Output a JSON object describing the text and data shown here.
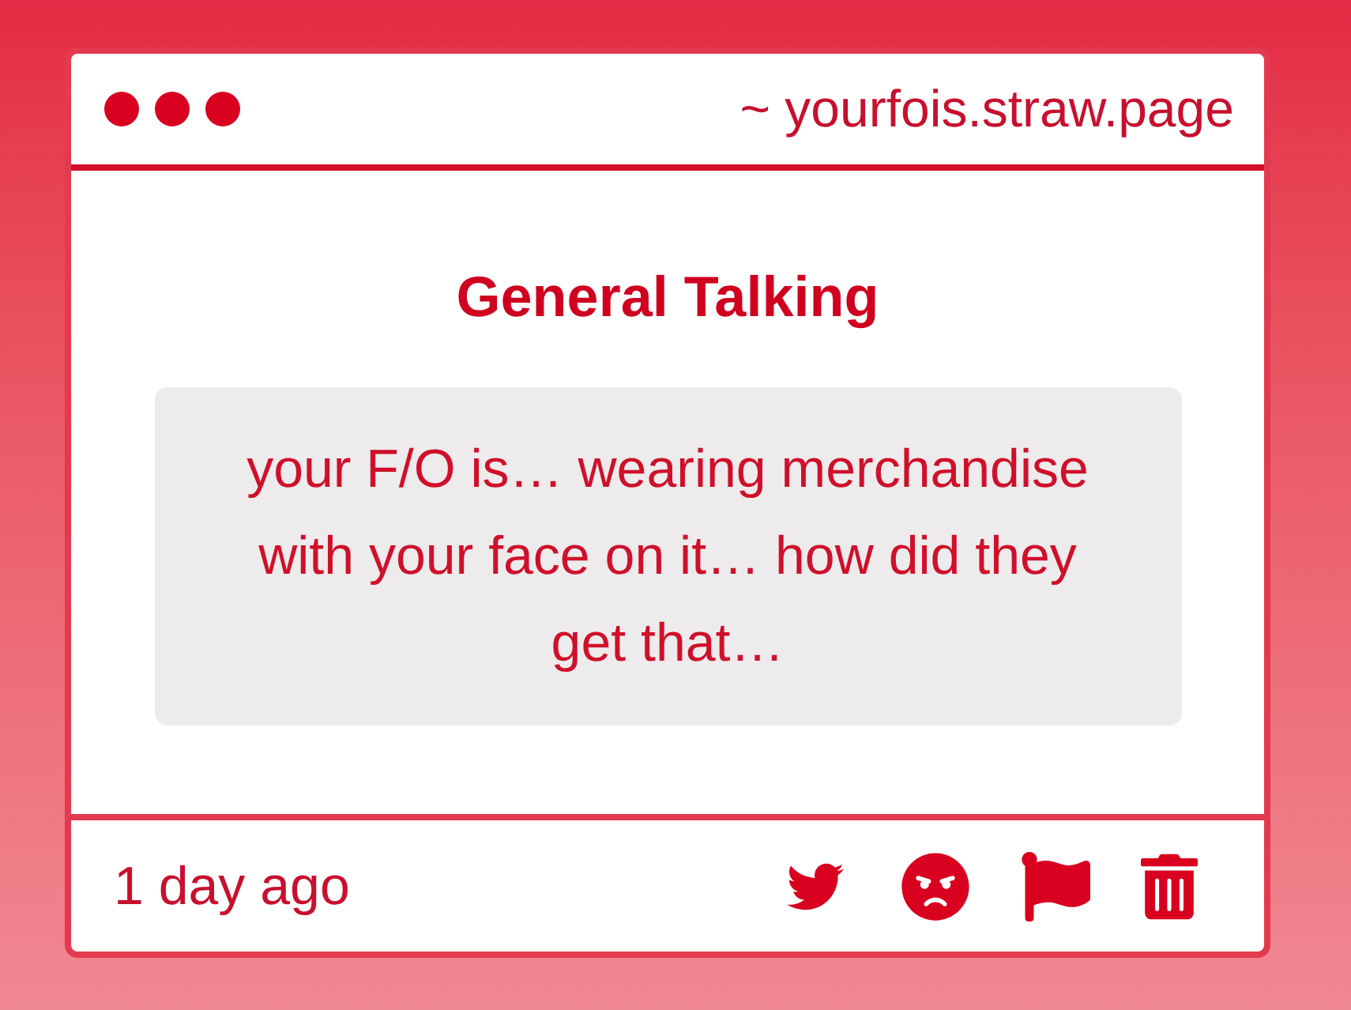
{
  "window": {
    "url": "~ yourfois.straw.page"
  },
  "post": {
    "title": "General Talking",
    "message": "your F/O is… wearing merchandise with your face on it… how did they get that…"
  },
  "footer": {
    "time": "1 day ago",
    "actions": [
      {
        "kind": "twitter"
      },
      {
        "kind": "angry"
      },
      {
        "kind": "flag"
      },
      {
        "kind": "trash"
      }
    ]
  }
}
